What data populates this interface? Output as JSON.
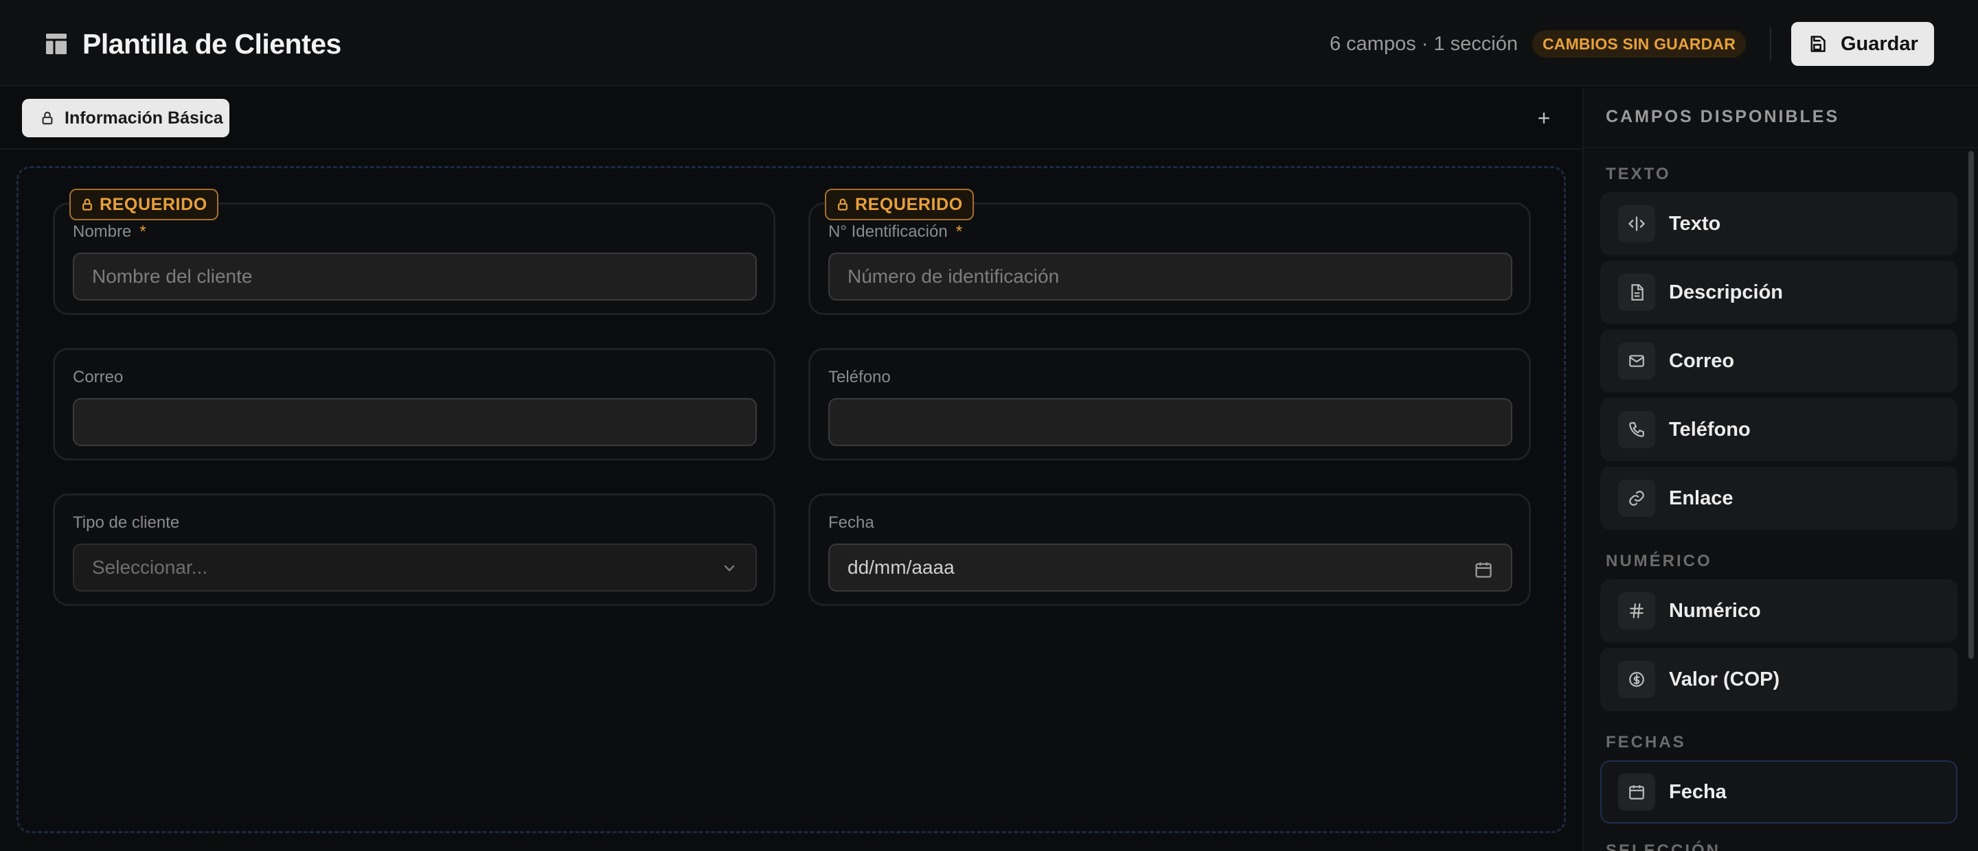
{
  "header": {
    "title": "Plantilla de Clientes",
    "meta": "6 campos · 1 sección",
    "status_badge": "CAMBIOS SIN GUARDAR",
    "save_label": "Guardar"
  },
  "tabs": [
    {
      "label": "Información Básica"
    }
  ],
  "add_tab_label": "+",
  "fields": [
    {
      "badge": "REQUERIDO",
      "label": "Nombre",
      "required_mark": "*",
      "placeholder": "Nombre del cliente"
    },
    {
      "badge": "REQUERIDO",
      "label": "N° Identificación",
      "required_mark": "*",
      "placeholder": "Número de identificación"
    },
    {
      "label": "Correo",
      "placeholder": ""
    },
    {
      "label": "Teléfono",
      "placeholder": ""
    },
    {
      "label": "Tipo de cliente",
      "placeholder": "Seleccionar..."
    },
    {
      "label": "Fecha",
      "placeholder": "dd/mm/aaaa"
    }
  ],
  "sidebar": {
    "title": "CAMPOS DISPONIBLES",
    "groups": [
      {
        "name": "TEXTO",
        "items": [
          {
            "label": "Texto",
            "icon": "text-cursor-icon"
          },
          {
            "label": "Descripción",
            "icon": "file-text-icon"
          },
          {
            "label": "Correo",
            "icon": "mail-icon"
          },
          {
            "label": "Teléfono",
            "icon": "phone-icon"
          },
          {
            "label": "Enlace",
            "icon": "link-icon"
          }
        ]
      },
      {
        "name": "NUMÉRICO",
        "items": [
          {
            "label": "Numérico",
            "icon": "hash-icon"
          },
          {
            "label": "Valor (COP)",
            "icon": "currency-icon"
          }
        ]
      },
      {
        "name": "FECHAS",
        "items": [
          {
            "label": "Fecha",
            "icon": "calendar-icon"
          }
        ]
      }
    ],
    "cut_off_label": "SELECCIÓN"
  },
  "colors": {
    "accent": "#e8a13a",
    "background": "#0b0c0e",
    "panel": "#0f1012",
    "active_border": "#1e2e52"
  }
}
